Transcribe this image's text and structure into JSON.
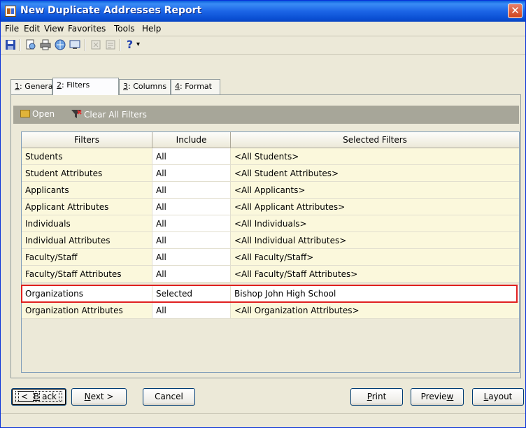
{
  "window": {
    "title": "New Duplicate Addresses Report",
    "close_glyph": "✕"
  },
  "menu": [
    "File",
    "Edit",
    "View",
    "Favorites",
    "Tools",
    "Help"
  ],
  "toolbar": {
    "help_glyph": "?",
    "dropdown_glyph": "▾"
  },
  "tabs": [
    {
      "key": "1",
      "label": ": General"
    },
    {
      "key": "2",
      "label": ": Filters"
    },
    {
      "key": "3",
      "label": ": Columns"
    },
    {
      "key": "4",
      "label": ": Format"
    }
  ],
  "subtoolbar": {
    "open_label": "Open",
    "clear_label": "Clear All Filters"
  },
  "grid": {
    "headers": [
      "Filters",
      "Include",
      "Selected Filters"
    ],
    "rows": [
      {
        "filter": "Students",
        "include": "All",
        "selected": "<All Students>"
      },
      {
        "filter": "Student Attributes",
        "include": "All",
        "selected": "<All Student Attributes>"
      },
      {
        "filter": "Applicants",
        "include": "All",
        "selected": "<All Applicants>"
      },
      {
        "filter": "Applicant Attributes",
        "include": "All",
        "selected": "<All Applicant Attributes>"
      },
      {
        "filter": "Individuals",
        "include": "All",
        "selected": "<All Individuals>"
      },
      {
        "filter": "Individual Attributes",
        "include": "All",
        "selected": "<All Individual Attributes>"
      },
      {
        "filter": "Faculty/Staff",
        "include": "All",
        "selected": "<All Faculty/Staff>"
      },
      {
        "filter": "Faculty/Staff Attributes",
        "include": "All",
        "selected": "<All Faculty/Staff Attributes>"
      },
      {
        "filter": "Organizations",
        "include": "Selected",
        "selected": "Bishop John High School"
      },
      {
        "filter": "Organization Attributes",
        "include": "All",
        "selected": "<All Organization Attributes>"
      }
    ]
  },
  "buttons": {
    "back": {
      "key": "B",
      "rest": "ack",
      "prefix": "< "
    },
    "next": {
      "key": "N",
      "rest": "ext >"
    },
    "cancel": "Cancel",
    "print": {
      "key": "P",
      "rest": "rint"
    },
    "preview": {
      "pre": "Previe",
      "key": "w"
    },
    "layout": {
      "key": "L",
      "rest": "ayout"
    }
  }
}
